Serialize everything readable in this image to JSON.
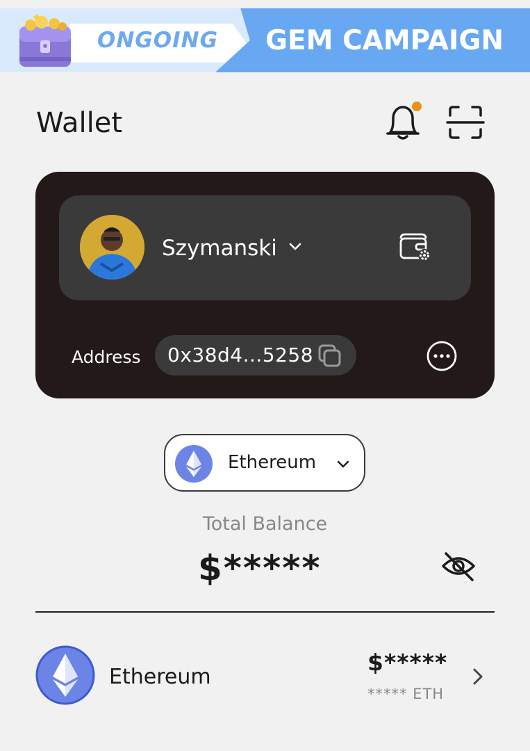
{
  "banner": {
    "tag": "ONGOING",
    "title": "GEM CAMPAIGN",
    "icon": "treasure-chest-icon"
  },
  "header": {
    "title": "Wallet",
    "notification_icon": "bell-icon",
    "scan_icon": "scan-icon"
  },
  "account": {
    "name": "Szymanski",
    "address_label": "Address",
    "address": "0x38d4...5258"
  },
  "network": {
    "name": "Ethereum"
  },
  "balance": {
    "label": "Total Balance",
    "value": "$*****"
  },
  "assets": [
    {
      "name": "Ethereum",
      "usd": "$*****",
      "amount": "***** ETH"
    }
  ],
  "colors": {
    "card": "#221918",
    "panel": "#3a3a3a",
    "accent_blue": "#68a8f2",
    "eth_blue": "#6b84e6",
    "notification_dot": "#e8921a"
  }
}
